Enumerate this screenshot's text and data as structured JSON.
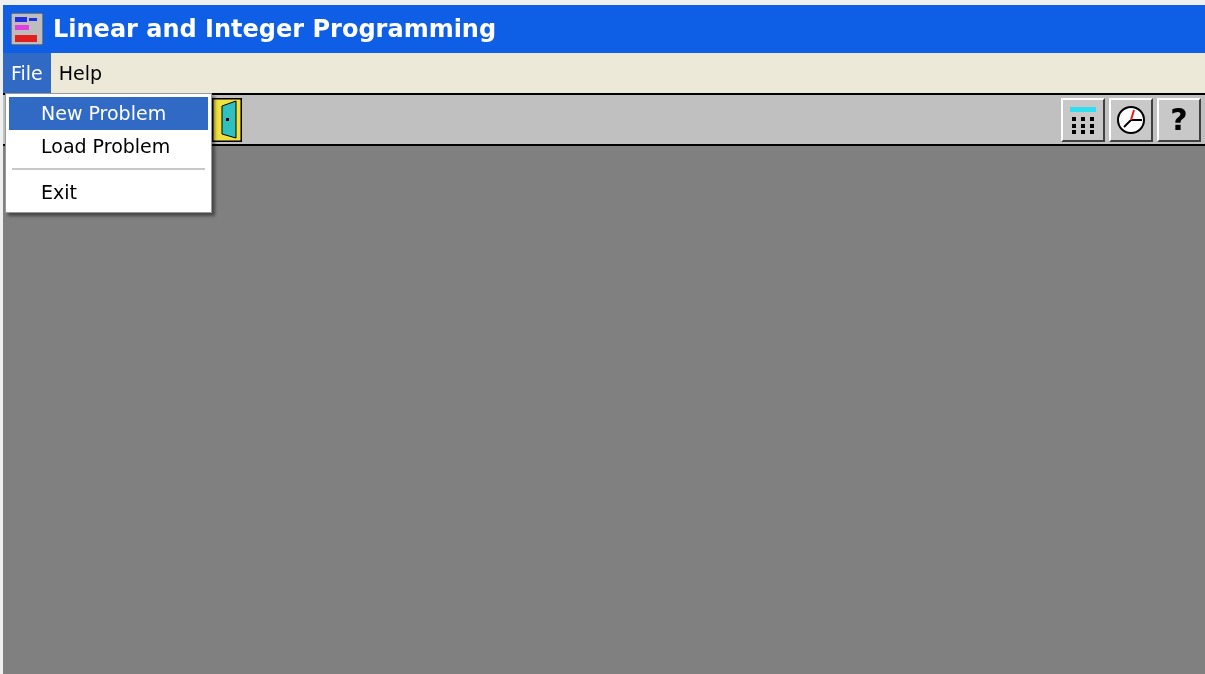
{
  "window": {
    "title": "Linear and Integer Programming"
  },
  "menu_bar": [
    {
      "label": "File",
      "selected": true
    },
    {
      "label": "Help",
      "selected": false
    }
  ],
  "dropdown": [
    {
      "kind": "item",
      "label": "New Problem",
      "selected": true
    },
    {
      "kind": "item",
      "label": "Load Problem",
      "selected": false
    },
    {
      "kind": "separator"
    },
    {
      "kind": "item",
      "label": "Exit",
      "selected": false
    }
  ],
  "toolbar": {
    "help_label": "?"
  }
}
